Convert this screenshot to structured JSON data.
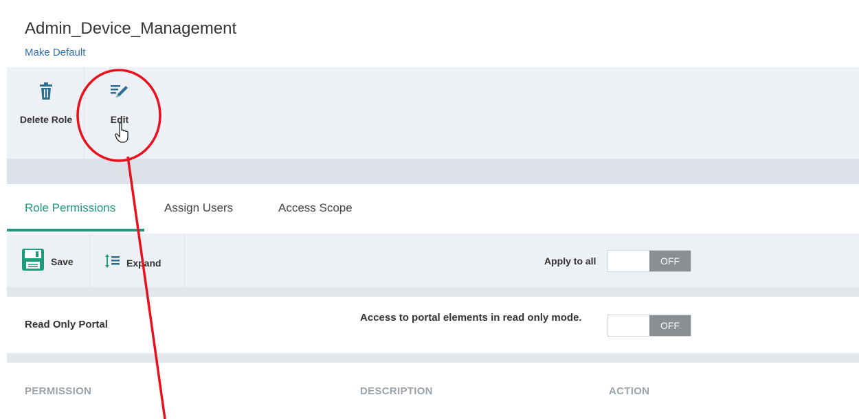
{
  "header": {
    "title": "Admin_Device_Management",
    "make_default": "Make Default"
  },
  "toolbar": {
    "delete_label": "Delete Role",
    "edit_label": "Edit"
  },
  "tabs": [
    {
      "label": "Role Permissions",
      "active": true
    },
    {
      "label": "Assign Users",
      "active": false
    },
    {
      "label": "Access Scope",
      "active": false
    }
  ],
  "actions": {
    "save_label": "Save",
    "expand_label": "Expand",
    "apply_all_label": "Apply to all",
    "apply_all_state": "OFF"
  },
  "read_only": {
    "title": "Read Only Portal",
    "description": "Access to portal elements in read only mode.",
    "state": "OFF"
  },
  "table": {
    "columns": [
      "PERMISSION",
      "DESCRIPTION",
      "ACTION"
    ]
  },
  "colors": {
    "accent": "#1d9b7a",
    "link": "#2f6fb6",
    "annotation": "#e8101c",
    "toggle_off": "#8a8f94"
  }
}
